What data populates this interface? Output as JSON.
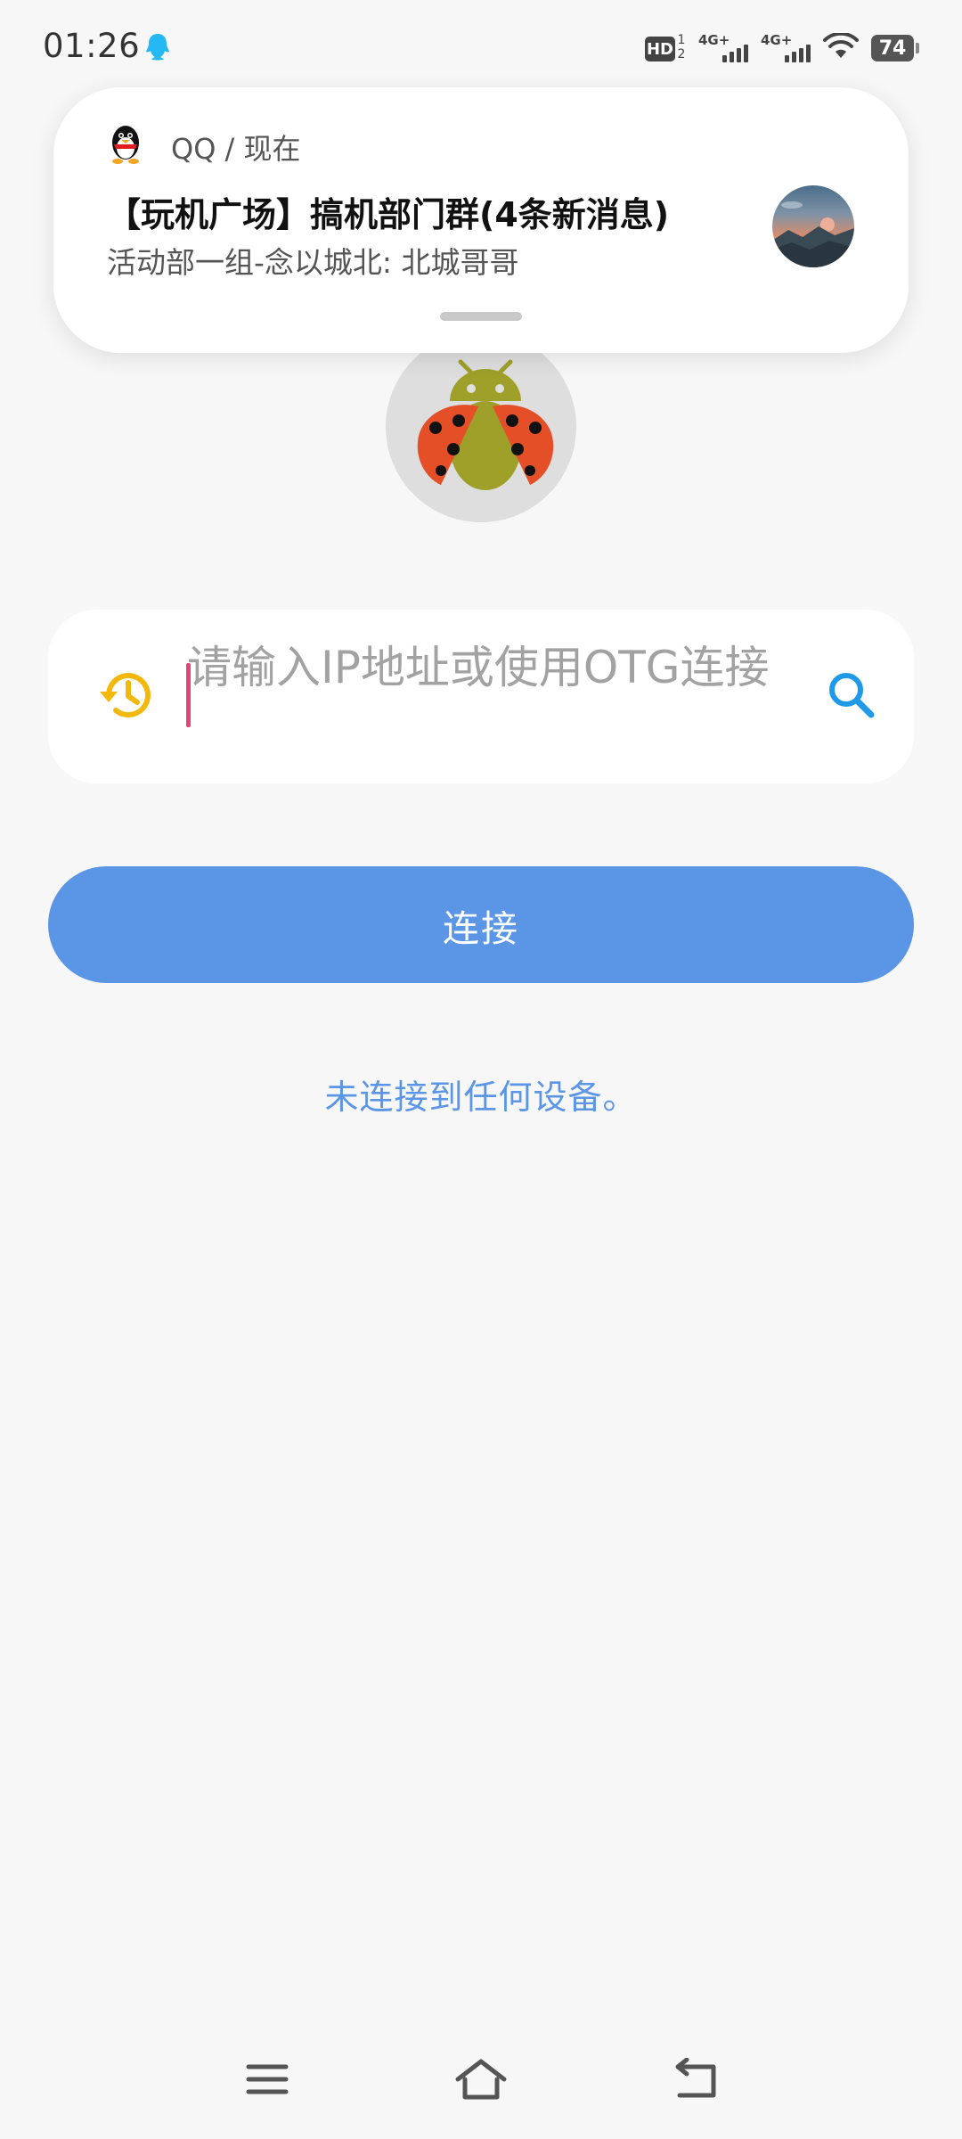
{
  "status_bar": {
    "time": "01:26",
    "hd_label": "HD",
    "hd_sub": "1 2",
    "signal_1_label": "4G+",
    "signal_2_label": "4G+",
    "battery_level": "74"
  },
  "notification": {
    "app_line": "QQ / 现在",
    "title": "【玩机广场】搞机部门群(4条新消息)",
    "body": "活动部一组-念以城北: 北城哥哥"
  },
  "address": {
    "placeholder": "请输入IP地址或使用OTG连接",
    "value": ""
  },
  "connect_button_label": "连接",
  "status_message": "未连接到任何设备。",
  "icons": {
    "status_qq": "qq-penguin-icon",
    "history": "history-icon",
    "search": "search-icon",
    "nav_menu": "menu-icon",
    "nav_home": "home-icon",
    "nav_back": "back-icon"
  },
  "colors": {
    "accent": "#5b95e6",
    "history_icon": "#f2b80c",
    "search_icon": "#1f9ae8",
    "caret": "#e2457b",
    "background": "#f7f7f8"
  }
}
